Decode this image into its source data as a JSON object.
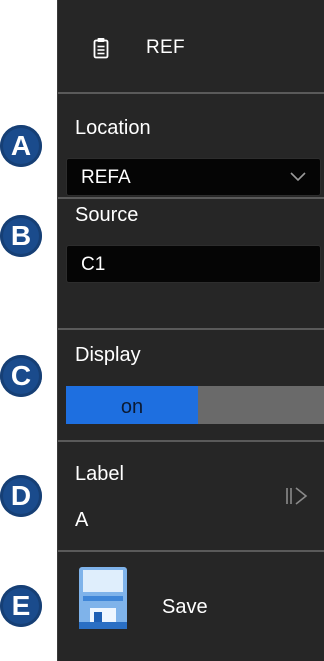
{
  "header": {
    "title": "REF",
    "icon": "clipboard-icon"
  },
  "location": {
    "label": "Location",
    "value": "REFA",
    "icon": "chevron-down-icon"
  },
  "source": {
    "label": "Source",
    "value": "C1"
  },
  "display": {
    "label": "Display",
    "on_label": "on",
    "state": "on",
    "on_color": "#1e6fe0",
    "off_color": "#6a6a6a"
  },
  "label_item": {
    "label": "Label",
    "value": "A",
    "icon": "enter-icon"
  },
  "save": {
    "label": "Save",
    "icon": "floppy-disk-icon"
  },
  "callouts": [
    "A",
    "B",
    "C",
    "D",
    "E"
  ],
  "colors": {
    "panel": "#262626",
    "badge": "#1a4b8c",
    "field": "#050505"
  }
}
